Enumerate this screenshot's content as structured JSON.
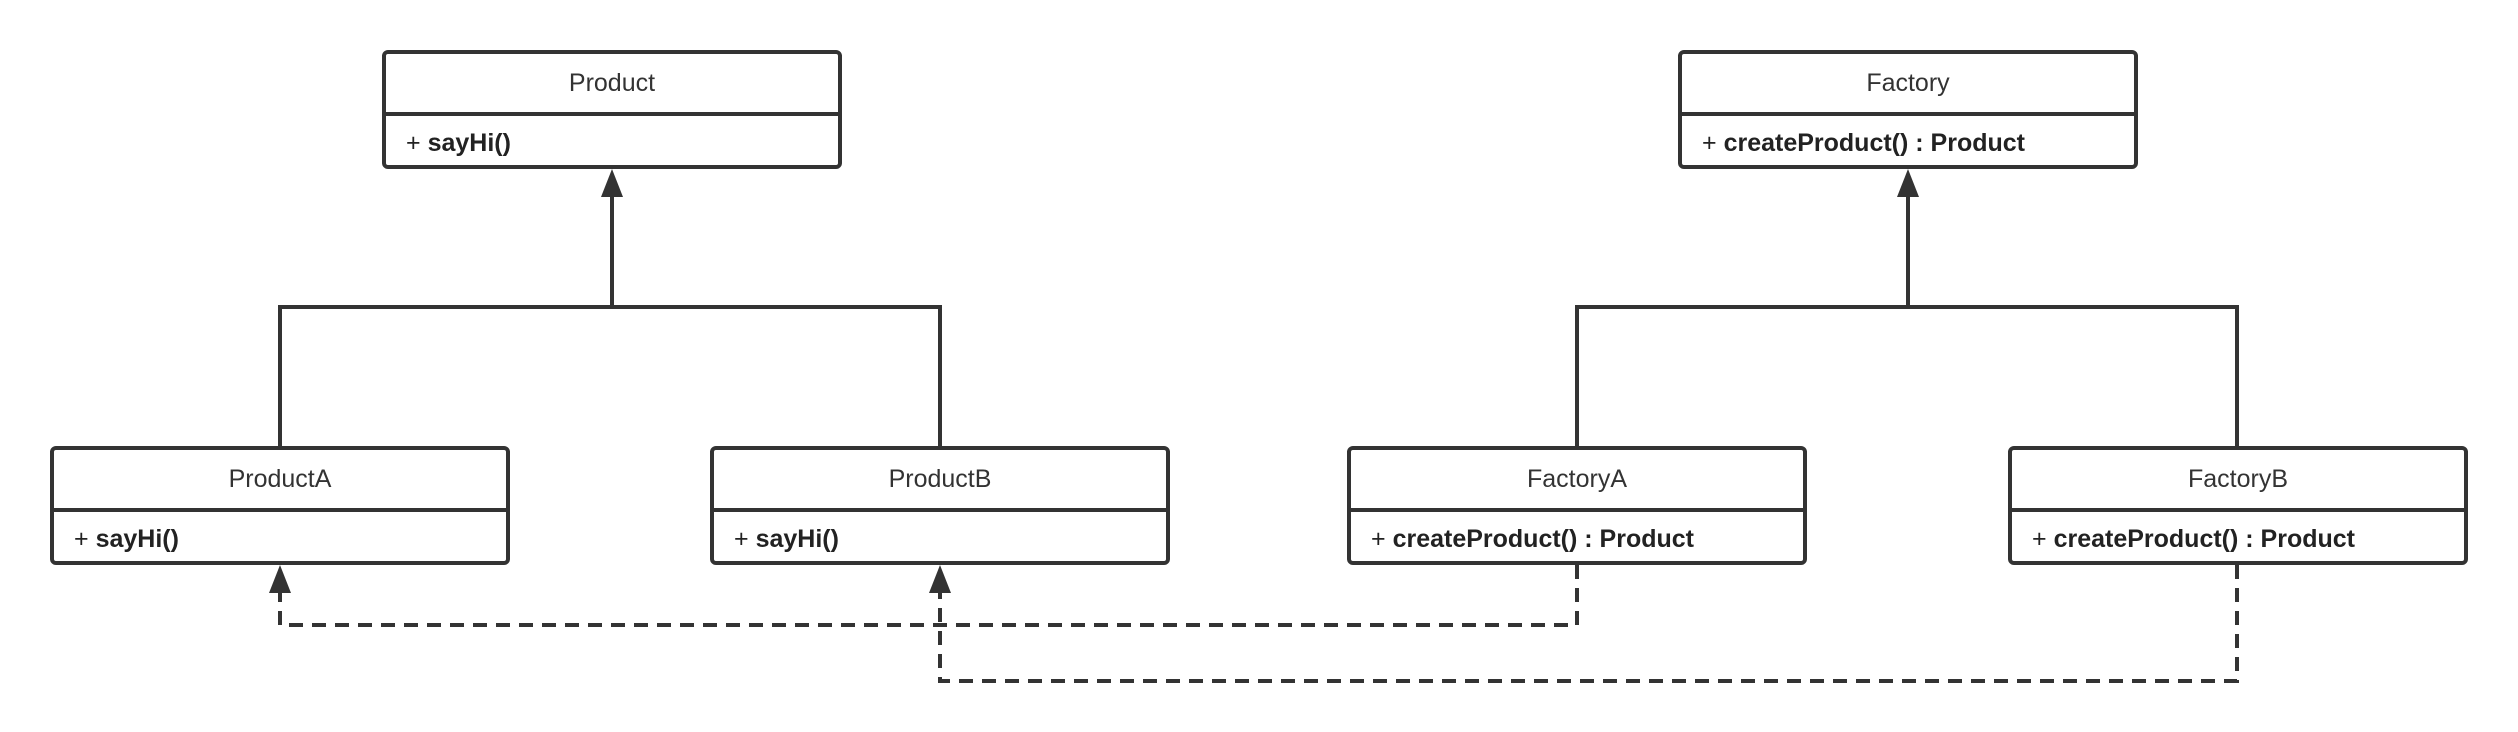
{
  "classes": {
    "product": {
      "name": "Product",
      "method_prefix": "+",
      "method": "sayHi()"
    },
    "factory": {
      "name": "Factory",
      "method_prefix": "+",
      "method": "createProduct() : Product"
    },
    "productA": {
      "name": "ProductA",
      "method_prefix": "+",
      "method": "sayHi()"
    },
    "productB": {
      "name": "ProductB",
      "method_prefix": "+",
      "method": "sayHi()"
    },
    "factoryA": {
      "name": "FactoryA",
      "method_prefix": "+",
      "method": "createProduct() : Product"
    },
    "factoryB": {
      "name": "FactoryB",
      "method_prefix": "+",
      "method": "createProduct() : Product"
    }
  },
  "relations": [
    {
      "type": "inheritance",
      "from": "ProductA",
      "to": "Product"
    },
    {
      "type": "inheritance",
      "from": "ProductB",
      "to": "Product"
    },
    {
      "type": "inheritance",
      "from": "FactoryA",
      "to": "Factory"
    },
    {
      "type": "inheritance",
      "from": "FactoryB",
      "to": "Factory"
    },
    {
      "type": "dependency",
      "from": "FactoryA",
      "to": "ProductA"
    },
    {
      "type": "dependency",
      "from": "FactoryB",
      "to": "ProductB"
    }
  ],
  "colors": {
    "stroke": "#333333",
    "background": "#ffffff"
  }
}
